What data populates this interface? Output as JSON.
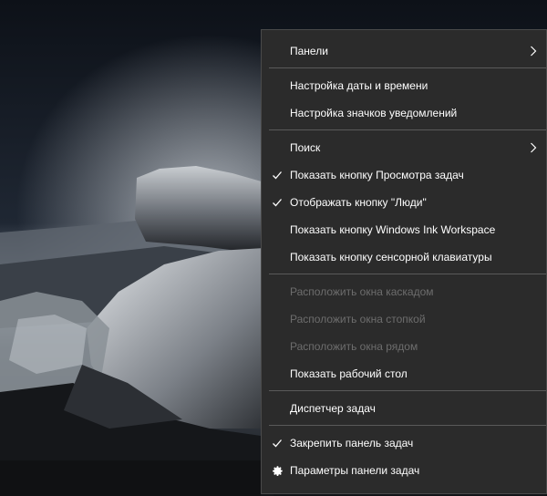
{
  "menu": {
    "groups": [
      [
        {
          "label": "Панели",
          "submenu": true
        }
      ],
      [
        {
          "label": "Настройка даты и времени"
        },
        {
          "label": "Настройка значков уведомлений"
        }
      ],
      [
        {
          "label": "Поиск",
          "submenu": true
        },
        {
          "label": "Показать кнопку Просмотра задач",
          "checked": true
        },
        {
          "label": "Отображать кнопку \"Люди\"",
          "checked": true
        },
        {
          "label": "Показать кнопку Windows Ink Workspace"
        },
        {
          "label": "Показать кнопку сенсорной клавиатуры"
        }
      ],
      [
        {
          "label": "Расположить окна каскадом",
          "disabled": true
        },
        {
          "label": "Расположить окна стопкой",
          "disabled": true
        },
        {
          "label": "Расположить окна рядом",
          "disabled": true
        },
        {
          "label": "Показать рабочий стол"
        }
      ],
      [
        {
          "label": "Диспетчер задач"
        }
      ],
      [
        {
          "label": "Закрепить панель задач",
          "checked": true
        },
        {
          "label": "Параметры панели задач",
          "icon": "gear-icon"
        }
      ]
    ]
  },
  "colors": {
    "menu_bg": "#2b2b2b",
    "text": "#ffffff",
    "disabled_text": "#6d6d6d",
    "separator": "#5a5a5a"
  }
}
